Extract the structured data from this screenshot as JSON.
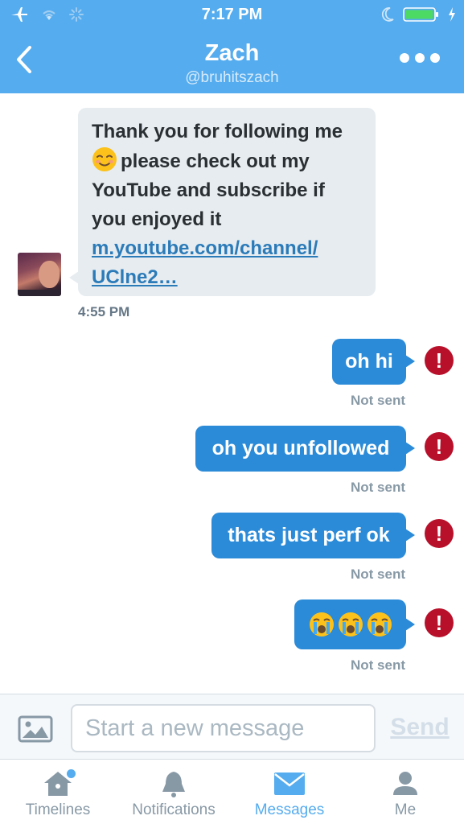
{
  "status_bar": {
    "time": "7:17 PM",
    "icons": [
      "airplane-icon",
      "wifi-icon",
      "activity-spinner-icon",
      "moon-icon",
      "battery-icon",
      "charging-bolt-icon"
    ]
  },
  "nav": {
    "back_icon": "chevron-left-icon",
    "title": "Zach",
    "subtitle": "@bruhitszach",
    "more_icon": "ellipsis-icon"
  },
  "incoming_message": {
    "line1": "Thank you for following me",
    "emoji": "relieved-face-emoji",
    "line2": "please check out my",
    "line3": "YouTube and subscribe if",
    "line4": "you enjoyed it",
    "link_line1": "m.youtube.com/channel/",
    "link_line2": "UClne2…",
    "time": "4:55 PM"
  },
  "outgoing_messages": [
    {
      "text": "oh hi",
      "status": "Not sent"
    },
    {
      "text": "oh you unfollowed",
      "status": "Not sent"
    },
    {
      "text": "thats just perf ok",
      "status": "Not sent"
    },
    {
      "emoji": [
        "loudly-crying-face-emoji",
        "loudly-crying-face-emoji",
        "loudly-crying-face-emoji"
      ],
      "status": "Not sent"
    }
  ],
  "error_icon_glyph": "!",
  "composer": {
    "photo_icon": "photo-icon",
    "placeholder": "Start a new message",
    "value": "",
    "send_label": "Send"
  },
  "tab_bar": {
    "tabs": [
      {
        "label": "Timelines",
        "icon": "home-icon",
        "active": false,
        "badge_dot": true
      },
      {
        "label": "Notifications",
        "icon": "bell-icon",
        "active": false
      },
      {
        "label": "Messages",
        "icon": "envelope-icon",
        "active": true
      },
      {
        "label": "Me",
        "icon": "person-icon",
        "active": false
      }
    ]
  },
  "colors": {
    "brand_blue": "#55acee",
    "outgoing_bubble": "#2b8bd8",
    "incoming_bubble": "#e6ecf0",
    "error_red": "#b8102a",
    "link": "#2b7bb9"
  }
}
